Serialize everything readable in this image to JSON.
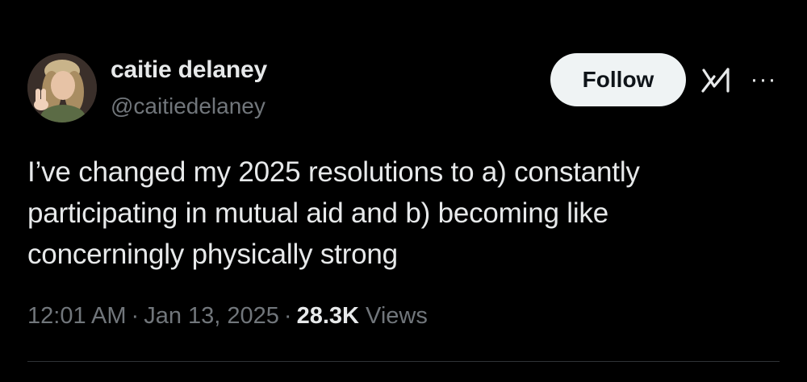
{
  "author": {
    "display_name": "caitie delaney",
    "handle": "@caitiedelaney",
    "avatar_icon": "user-avatar-photo"
  },
  "actions": {
    "follow_label": "Follow",
    "grok_icon": "grok-icon",
    "more_icon": "more-horizontal-icon",
    "more_glyph": "···"
  },
  "tweet": {
    "text": "I’ve changed my 2025 resolutions to a) constantly\nparticipating in mutual aid and b) becoming like\nconcerningly physically strong"
  },
  "meta": {
    "time": "12:01 AM",
    "separator": "·",
    "date": "Jan 13, 2025",
    "views_count": "28.3K",
    "views_label": "Views"
  },
  "colors": {
    "background": "#000000",
    "primary_text": "#e7e9ea",
    "secondary_text": "#71767b",
    "follow_button_bg": "#eff3f4",
    "follow_button_text": "#0f1419",
    "divider": "#2f3336"
  }
}
